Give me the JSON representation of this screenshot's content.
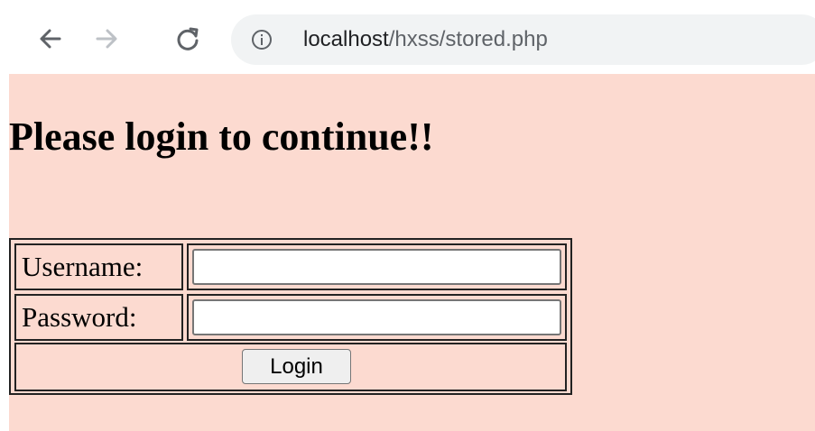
{
  "browser": {
    "url_host": "localhost",
    "url_path": "/hxss/stored.php"
  },
  "page": {
    "heading": "Please login to continue!!",
    "background_color": "#fcdad0",
    "form": {
      "username_label": "Username:",
      "username_value": "",
      "password_label": "Password:",
      "password_value": "",
      "login_button_label": "Login"
    }
  }
}
